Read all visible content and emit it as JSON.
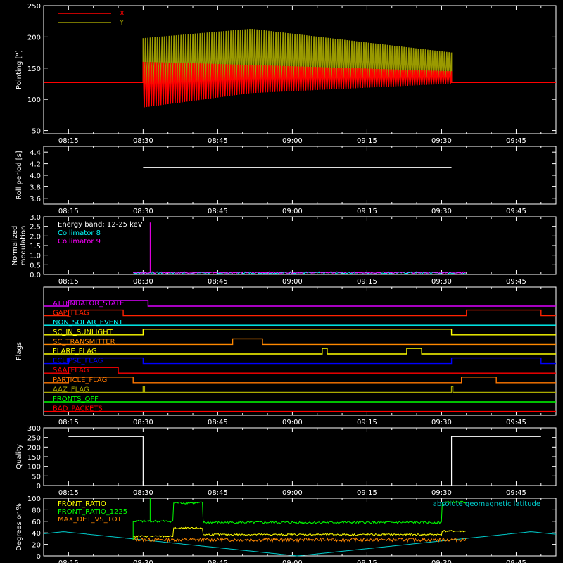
{
  "chart_data": [
    {
      "type": "line",
      "ylabel": "Pointing [\"]",
      "ylim": [
        45,
        250
      ],
      "yticks": [
        50,
        100,
        150,
        200,
        250
      ],
      "xticks": [
        "08:15",
        "08:30",
        "08:45",
        "09:00",
        "09:15",
        "09:30",
        "09:45"
      ],
      "series": [
        {
          "name": "X",
          "color": "#ff0000",
          "baseline": 127,
          "active_range": [
            "08:30",
            "09:32"
          ],
          "band_start": [
            87,
            160
          ],
          "band_mid": [
            110,
            155
          ],
          "band_end": [
            125,
            145
          ]
        },
        {
          "name": "Y",
          "color": "#9a9a00",
          "baseline": 127,
          "active_range": [
            "08:30",
            "09:32"
          ],
          "band_start": [
            110,
            198
          ],
          "band_mid": [
            120,
            213
          ],
          "band_end": [
            128,
            175
          ]
        }
      ]
    },
    {
      "type": "line",
      "ylabel": "Roll period [s]",
      "ylim": [
        3.5,
        4.5
      ],
      "yticks": [
        3.6,
        3.8,
        4.0,
        4.2,
        4.4
      ],
      "ytick_labels": [
        "3.6",
        "3.8",
        "4.0",
        "4.2",
        "4.4"
      ],
      "xticks": [
        "08:15",
        "08:30",
        "08:45",
        "09:00",
        "09:15",
        "09:30",
        "09:45"
      ],
      "series": [
        {
          "color": "#ffffff",
          "x_range": [
            "08:30",
            "09:32"
          ],
          "value": 4.13
        }
      ]
    },
    {
      "type": "line",
      "ylabel": "Normalized modulation",
      "ylabel_lines": [
        "Normalized",
        "modulation"
      ],
      "ylim": [
        0,
        3.0
      ],
      "yticks": [
        0,
        0.5,
        1.0,
        1.5,
        2.0,
        2.5,
        3.0
      ],
      "ytick_labels": [
        "0.0",
        "0.5",
        "1.0",
        "1.5",
        "2.0",
        "2.5",
        "3.0"
      ],
      "xticks": [
        "08:15",
        "08:30",
        "08:45",
        "09:00",
        "09:15",
        "09:30",
        "09:45"
      ],
      "annotations": [
        "Energy band: 12-25 keV"
      ],
      "series": [
        {
          "name": "Collimator 8",
          "color": "#00ffff",
          "x_range": [
            "08:28",
            "09:35"
          ],
          "level": 0.08
        },
        {
          "name": "Collimator 9",
          "color": "#ff00ff",
          "x_range": [
            "08:28",
            "09:35"
          ],
          "level": 0.1,
          "spike_at": "08:30",
          "spike_value": 2.7
        }
      ]
    },
    {
      "type": "line",
      "ylabel": "Flags",
      "xticks": [
        "08:15",
        "08:30",
        "08:45",
        "09:00",
        "09:15",
        "09:30",
        "09:45"
      ],
      "flags": [
        {
          "name": "ATTENUATOR_STATE",
          "color": "#dd00ff",
          "on": [
            [
              "08:15",
              "08:31"
            ]
          ]
        },
        {
          "name": "GAP_FLAG",
          "color": "#ff2200",
          "on": [
            [
              "08:15",
              "08:26"
            ],
            [
              "09:35",
              "09:50"
            ]
          ]
        },
        {
          "name": "NON_SOLAR_EVENT",
          "color": "#00ffff",
          "on": []
        },
        {
          "name": "SC_IN_SUNLIGHT",
          "color": "#ffff00",
          "on": [
            [
              "08:30",
              "09:32"
            ]
          ]
        },
        {
          "name": "SC_TRANSMITTER",
          "color": "#ff8800",
          "on": [
            [
              "08:48",
              "08:54"
            ]
          ]
        },
        {
          "name": "FLARE_FLAG",
          "color": "#ffff00",
          "on": [
            [
              "09:06",
              "09:07"
            ],
            [
              "09:23",
              "09:26"
            ]
          ]
        },
        {
          "name": "ECLIPSE_FLAG",
          "color": "#0000ff",
          "on": [
            [
              "08:15",
              "08:30"
            ],
            [
              "09:32",
              "09:50"
            ]
          ]
        },
        {
          "name": "SAA_FLAG",
          "color": "#ff0000",
          "on": [
            [
              "08:15",
              "08:25"
            ]
          ]
        },
        {
          "name": "PARTICLE_FLAG",
          "color": "#ff7700",
          "on": [
            [
              "08:15",
              "08:28"
            ],
            [
              "09:34",
              "09:41"
            ]
          ]
        },
        {
          "name": "AAZ_FLAG",
          "color": "#aaaa00",
          "on": [
            [
              "08:30",
              "08:30"
            ],
            [
              "09:32",
              "09:32"
            ]
          ]
        },
        {
          "name": "FRONTS_OFF",
          "color": "#00ff00",
          "on": []
        },
        {
          "name": "BAD_PACKETS",
          "color": "#ff0000",
          "on": []
        }
      ]
    },
    {
      "type": "line",
      "ylabel": "Quality",
      "ylim": [
        0,
        300
      ],
      "yticks": [
        0,
        50,
        100,
        150,
        200,
        250,
        300
      ],
      "xticks": [
        "08:15",
        "08:30",
        "08:45",
        "09:00",
        "09:15",
        "09:30",
        "09:45"
      ],
      "series": [
        {
          "color": "#ffffff",
          "segments": [
            {
              "x": [
                "08:15",
                "08:30"
              ],
              "y": 255
            },
            {
              "x": [
                "08:30",
                "09:32"
              ],
              "y": 0
            },
            {
              "x": [
                "09:32",
                "09:50"
              ],
              "y": 255
            }
          ]
        }
      ]
    },
    {
      "type": "line",
      "ylabel": "Degrees or %",
      "ylim": [
        0,
        100
      ],
      "yticks": [
        0,
        20,
        40,
        60,
        80,
        100
      ],
      "xticks": [
        "08:15",
        "08:30",
        "08:45",
        "09:00",
        "09:15",
        "09:30",
        "09:45"
      ],
      "series": [
        {
          "name": "FRONT_RATIO",
          "color": "#ffff00"
        },
        {
          "name": "FRONT_RATIO_1225",
          "color": "#00ff00"
        },
        {
          "name": "MAX_DET_VS_TOT",
          "color": "#ff8800"
        },
        {
          "name": "absolute geomagnetic latitude",
          "color": "#00cccc"
        }
      ]
    }
  ]
}
